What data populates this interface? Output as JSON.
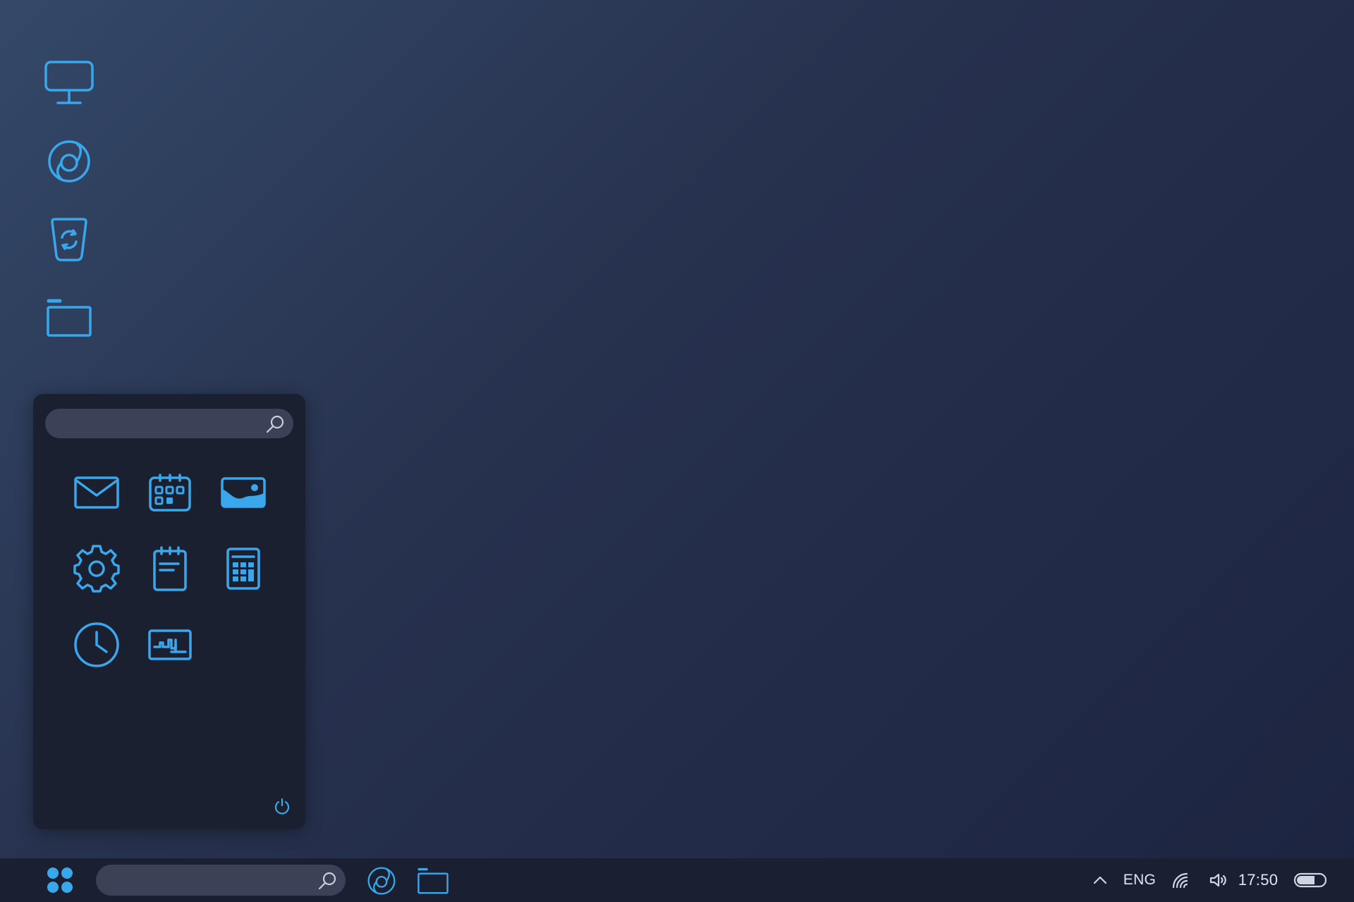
{
  "desktop": {
    "icons": [
      {
        "name": "monitor-icon"
      },
      {
        "name": "browser-icon"
      },
      {
        "name": "recycle-bin-icon"
      },
      {
        "name": "folder-icon"
      }
    ]
  },
  "start_menu": {
    "search": {
      "placeholder": "",
      "value": ""
    },
    "apps": [
      {
        "icon": "mail-icon"
      },
      {
        "icon": "calendar-icon"
      },
      {
        "icon": "photos-icon"
      },
      {
        "icon": "settings-gear-icon"
      },
      {
        "icon": "notepad-icon"
      },
      {
        "icon": "calculator-icon"
      },
      {
        "icon": "clock-icon"
      },
      {
        "icon": "system-monitor-icon"
      }
    ],
    "power_icon": "power-icon"
  },
  "taskbar": {
    "search": {
      "placeholder": "",
      "value": ""
    },
    "pinned": [
      {
        "icon": "browser-icon"
      },
      {
        "icon": "folder-icon"
      }
    ],
    "tray": {
      "language": "ENG",
      "time": "17:50"
    }
  },
  "colors": {
    "accent": "#3aa7ec",
    "taskbar_bg": "#1a2031",
    "menu_bg": "#1b2030",
    "search_bg": "#3b4258"
  }
}
